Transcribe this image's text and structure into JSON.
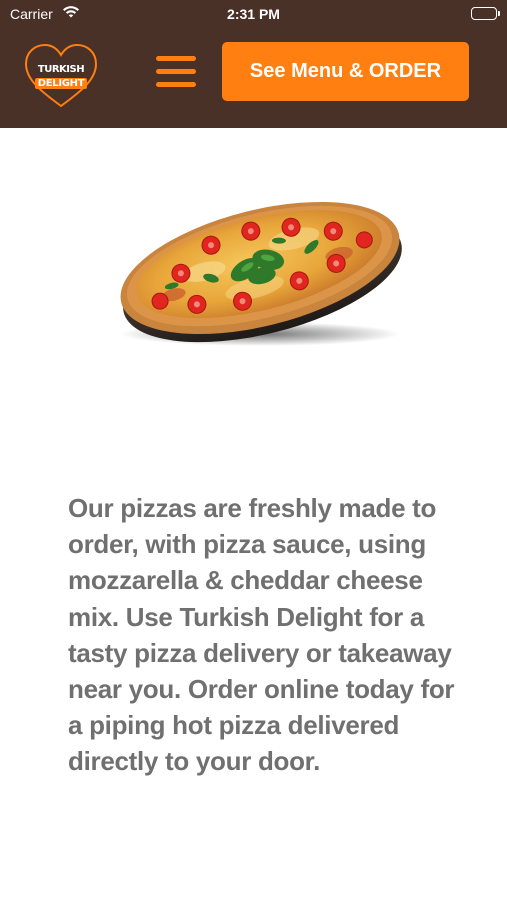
{
  "status_bar": {
    "carrier": "Carrier",
    "time": "2:31 PM",
    "wifi_icon": "wifi-icon",
    "battery_icon": "battery-icon"
  },
  "header": {
    "logo": {
      "line1": "TURKISH",
      "line2": "DELIGHT",
      "color_brand": "#ff7f11"
    },
    "menu_icon": "hamburger-menu-icon",
    "cta_label": "See Menu & ORDER",
    "background": "#4a3128",
    "accent": "#ff7f11"
  },
  "hero": {
    "image": "pizza-image"
  },
  "content": {
    "description": "Our pizzas are freshly made to order, with pizza sauce, using mozzarella & cheddar cheese mix. Use Turkish Delight for a tasty pizza delivery or takeaway near you. Order online today for a piping hot pizza delivered directly to your door."
  }
}
